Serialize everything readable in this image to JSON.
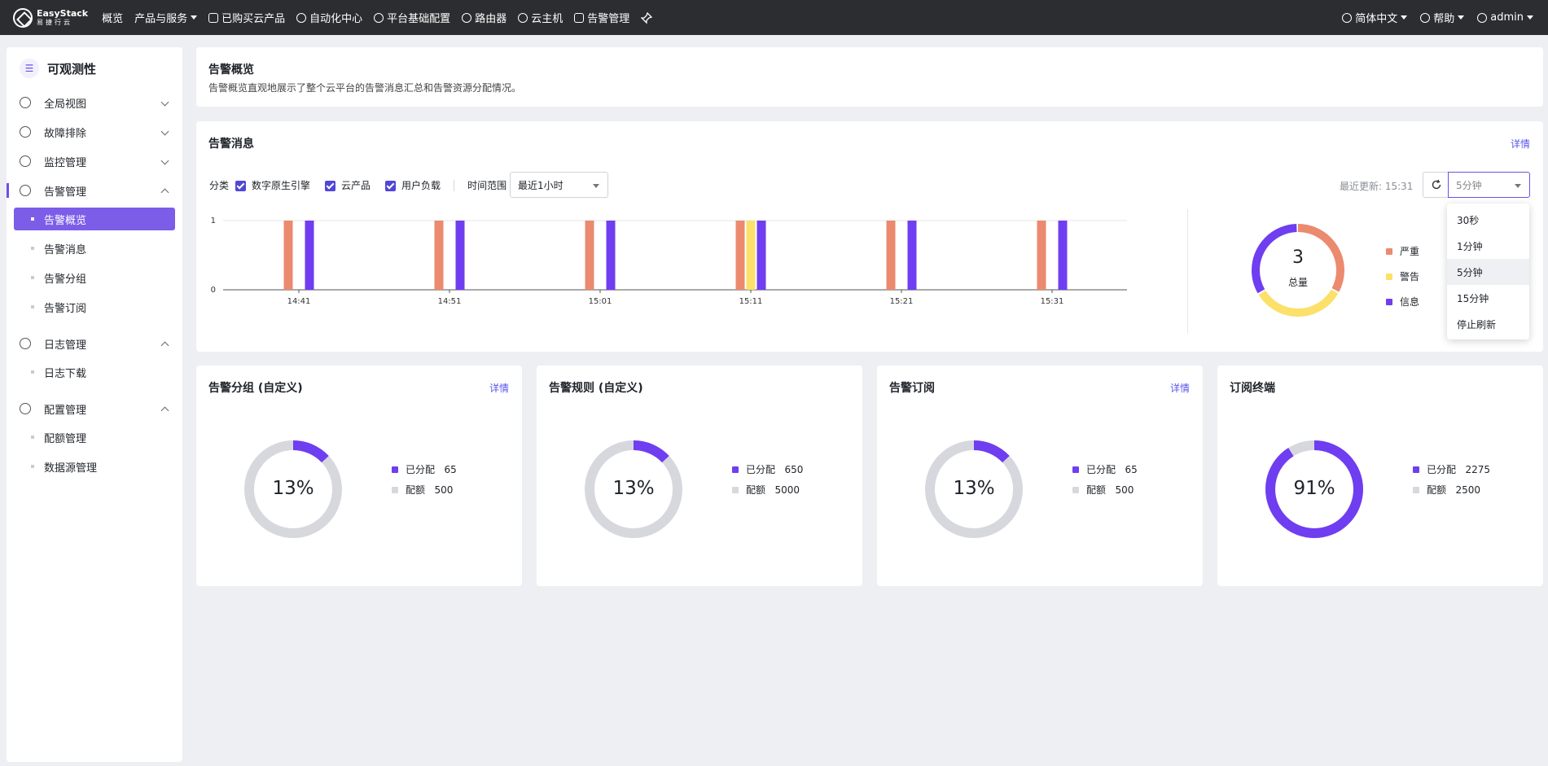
{
  "topbar": {
    "brand": "EasyStack",
    "brand_sub": "易捷行云",
    "nav": [
      "概览",
      "产品与服务",
      "已购买云产品",
      "自动化中心",
      "平台基础配置",
      "路由器",
      "云主机",
      "告警管理"
    ],
    "language": "简体中文",
    "help": "帮助",
    "user": "admin"
  },
  "sidebar": {
    "title": "可观测性",
    "groups": [
      "全局视图",
      "故障排除",
      "监控管理",
      "告警管理",
      "日志管理",
      "配置管理"
    ],
    "alert_items": [
      "告警概览",
      "告警消息",
      "告警分组",
      "告警订阅"
    ],
    "log_items": [
      "日志下载"
    ],
    "config_items": [
      "配额管理",
      "数据源管理"
    ]
  },
  "overview": {
    "title": "告警概览",
    "desc": "告警概览直观地展示了整个云平台的告警消息汇总和告警资源分配情况。"
  },
  "messages": {
    "title": "告警消息",
    "detail": "详情",
    "category_label": "分类",
    "categories": [
      "数字原生引擎",
      "云产品",
      "用户负载"
    ],
    "time_label": "时间范围",
    "time_value": "最近1小时",
    "last_update": "最近更新: 15:31",
    "refresh_value": "5分钟",
    "refresh_options": [
      "30秒",
      "1分钟",
      "5分钟",
      "15分钟",
      "停止刷新"
    ],
    "total_value": "3",
    "total_label": "总量",
    "legend": [
      "严重",
      "警告",
      "信息"
    ]
  },
  "colors": {
    "critical": "#eb8a6e",
    "warning": "#fbe06a",
    "info": "#6f3ef0",
    "track": "#d7d8de",
    "accent": "#7b5de8"
  },
  "chart_data": {
    "type": "bar",
    "categories": [
      "14:41",
      "14:51",
      "15:01",
      "15:11",
      "15:21",
      "15:31"
    ],
    "series": [
      {
        "name": "严重",
        "values": [
          1,
          1,
          1,
          1,
          1,
          1
        ]
      },
      {
        "name": "警告",
        "values": [
          0,
          0,
          0,
          1,
          0,
          0
        ]
      },
      {
        "name": "信息",
        "values": [
          1,
          1,
          1,
          1,
          1,
          1
        ]
      }
    ],
    "ylim": [
      0,
      1
    ],
    "yticks": [
      "0",
      "1"
    ],
    "donut": {
      "total": 3,
      "values": [
        1,
        1,
        1
      ]
    }
  },
  "quota_cards": [
    {
      "title": "告警分组 (自定义)",
      "detail": "详情",
      "percent": "13%",
      "ratio": 0.13,
      "allocated_label": "已分配",
      "allocated": "65",
      "quota_label": "配额",
      "quota": "500"
    },
    {
      "title": "告警规则 (自定义)",
      "detail": "",
      "percent": "13%",
      "ratio": 0.13,
      "allocated_label": "已分配",
      "allocated": "650",
      "quota_label": "配额",
      "quota": "5000"
    },
    {
      "title": "告警订阅",
      "detail": "详情",
      "percent": "13%",
      "ratio": 0.13,
      "allocated_label": "已分配",
      "allocated": "65",
      "quota_label": "配额",
      "quota": "500"
    },
    {
      "title": "订阅终端",
      "detail": "",
      "percent": "91%",
      "ratio": 0.91,
      "allocated_label": "已分配",
      "allocated": "2275",
      "quota_label": "配额",
      "quota": "2500"
    }
  ]
}
